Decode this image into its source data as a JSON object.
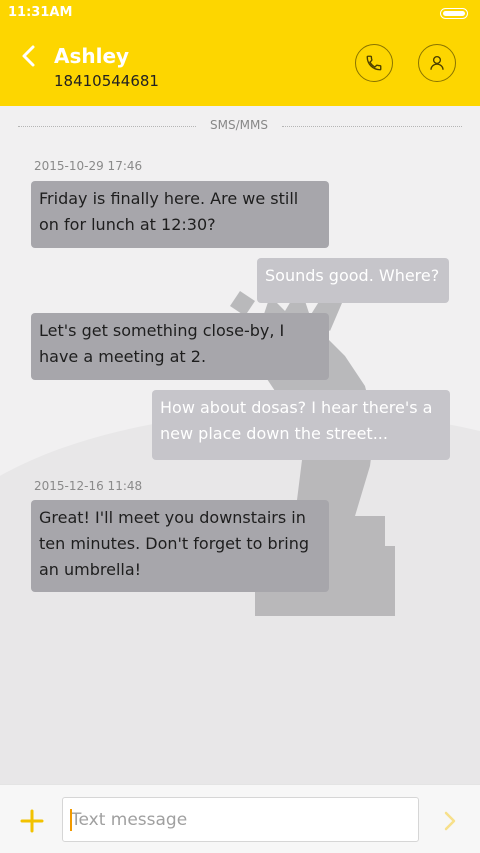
{
  "status_bar": {
    "time": "11:31AM"
  },
  "header": {
    "contact_name": "Ashley",
    "contact_number": "18410544681"
  },
  "thread": {
    "channel_label": "SMS/MMS",
    "messages": [
      {
        "timestamp": "2015-10-29 17:46",
        "direction": "incoming",
        "text": "Friday is finally here. Are we still on for lunch at 12:30?"
      },
      {
        "direction": "outgoing",
        "text": "Sounds good. Where?"
      },
      {
        "direction": "incoming",
        "text": "Let's get something close-by, I have a meeting at 2."
      },
      {
        "direction": "outgoing",
        "text": "How about dosas? I hear there's a new place down the street..."
      },
      {
        "timestamp": "2015-12-16 11:48",
        "direction": "incoming",
        "text": "Great! I'll meet you downstairs in ten minutes. Don't forget to bring an umbrella!"
      }
    ]
  },
  "composer": {
    "placeholder": "Text message"
  },
  "icons": {
    "back": "chevron-left-icon",
    "call": "phone-icon",
    "contact": "person-icon",
    "attach": "plus-icon",
    "send": "chevron-right-icon"
  },
  "colors": {
    "header": "#fdd600",
    "incoming_bubble": "#a7a6ab",
    "outgoing_bubble": "#c6c5ca",
    "accent": "#f29a00"
  }
}
